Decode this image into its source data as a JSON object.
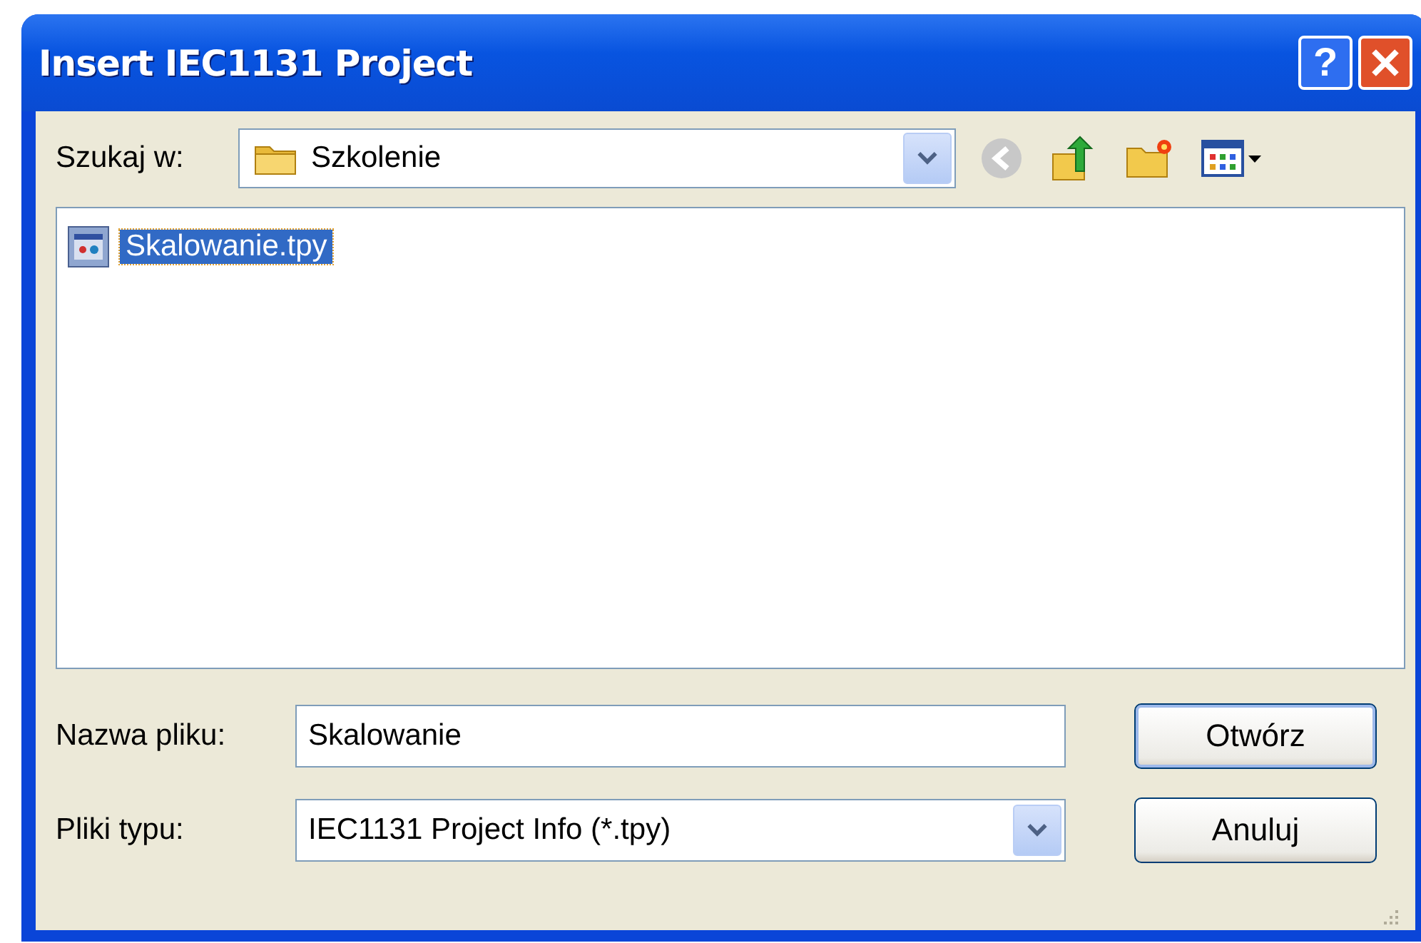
{
  "window": {
    "title": "Insert IEC1131 Project",
    "help_button": "?"
  },
  "look_in": {
    "label": "Szukaj w:",
    "value": "Szkolenie"
  },
  "files": [
    {
      "name": "Skalowanie.tpy",
      "selected": true
    }
  ],
  "file_name": {
    "label": "Nazwa pliku:",
    "value": "Skalowanie"
  },
  "file_type": {
    "label": "Pliki typu:",
    "value": "IEC1131 Project Info (*.tpy)"
  },
  "buttons": [
    {
      "label": "Otwórz",
      "default": true
    },
    {
      "label": "Anuluj",
      "default": false
    }
  ]
}
